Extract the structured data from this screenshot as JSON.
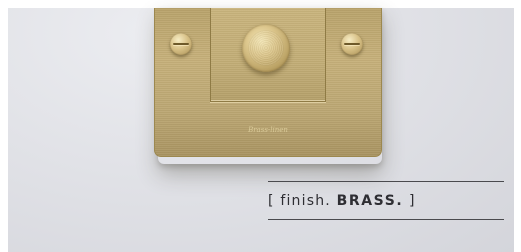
{
  "caption": {
    "open_bracket": "[",
    "prefix": "finish.",
    "emphasis": "BRASS.",
    "close_bracket": "]"
  },
  "plate": {
    "engraving_text": "Brass-linen",
    "finish_color": "#c2ad76"
  },
  "colors": {
    "wall": "#dedfe4",
    "rule": "#4a4a4e",
    "text": "#2e2e33"
  }
}
